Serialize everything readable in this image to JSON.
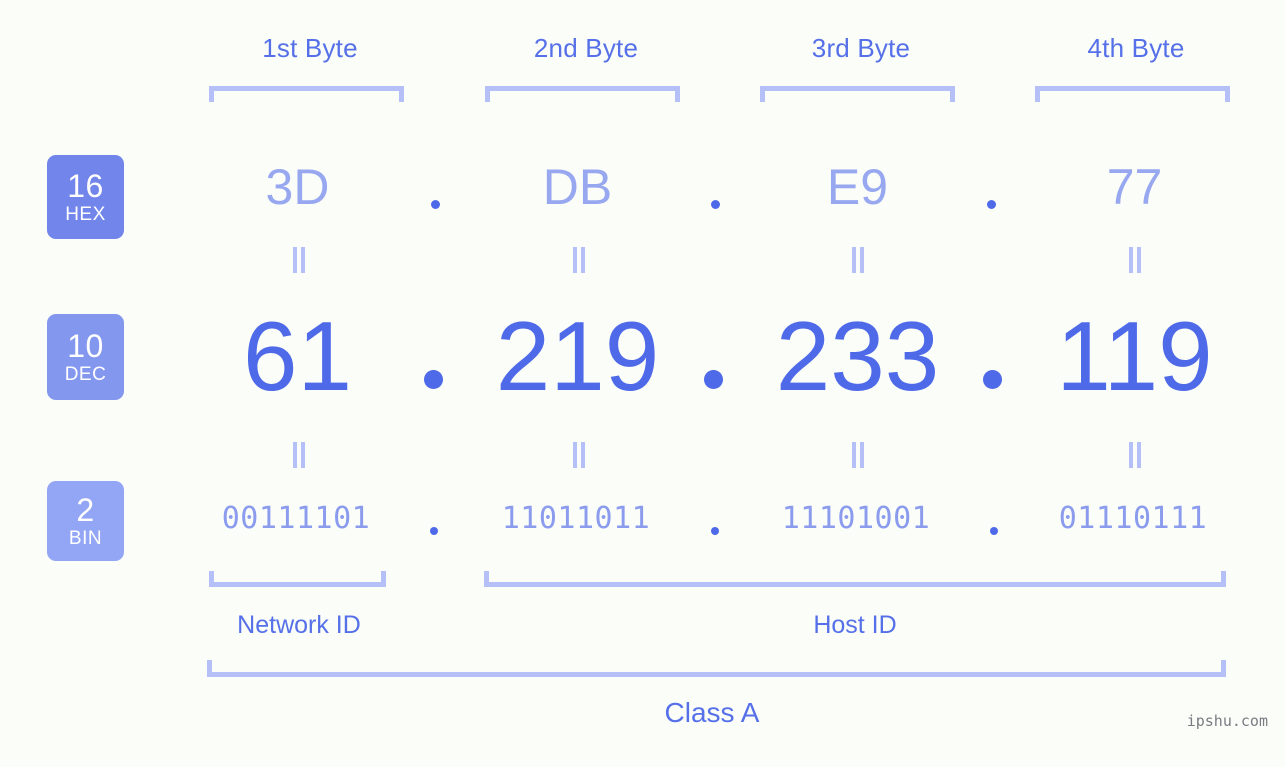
{
  "page": {
    "background_color": "#fbfdf8",
    "accent_color": "#5570e8",
    "bracket_color": "#b6c0f8",
    "watermark": "ipshu.com"
  },
  "byte_headers": [
    {
      "label": "1st Byte"
    },
    {
      "label": "2nd Byte"
    },
    {
      "label": "3rd Byte"
    },
    {
      "label": "4th Byte"
    }
  ],
  "bases": [
    {
      "number": "16",
      "unit": "HEX",
      "badge_color": "#7185ea"
    },
    {
      "number": "10",
      "unit": "DEC",
      "badge_color": "#8497ef"
    },
    {
      "number": "2",
      "unit": "BIN",
      "badge_color": "#93a6f5"
    }
  ],
  "rows": {
    "hex": {
      "values": [
        "3D",
        "DB",
        "E9",
        "77"
      ],
      "separator": "."
    },
    "dec": {
      "values": [
        "61",
        "219",
        "233",
        "119"
      ],
      "separator": "."
    },
    "bin": {
      "values": [
        "00111101",
        "11011011",
        "11101001",
        "01110111"
      ],
      "separator": "."
    }
  },
  "equals_mark": "‖",
  "segments": {
    "network_id": "Network ID",
    "host_id": "Host ID",
    "ip_class": "Class A"
  }
}
